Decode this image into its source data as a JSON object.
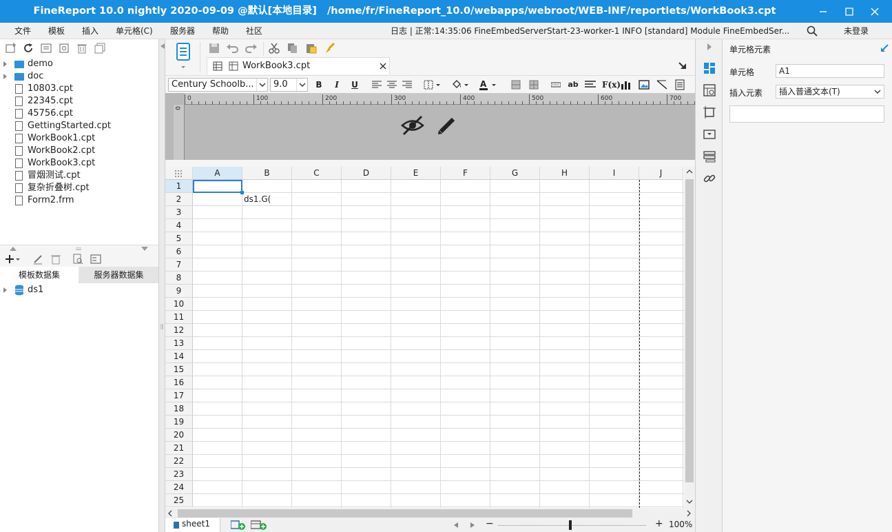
{
  "window": {
    "title": "FineReport 10.0 nightly 2020-09-09 @默认[本地目录]   /home/fr/FineReport_10.0/webapps/webroot/WEB-INF/reportlets/WorkBook3.cpt"
  },
  "menu": {
    "items": [
      "文件",
      "模板",
      "插入",
      "单元格(C)",
      "服务器",
      "帮助",
      "社区"
    ],
    "log": "日志 | 正常:14:35:06 FineEmbedServerStart-23-worker-1 INFO [standard] Module FineEmbedSer...",
    "login": "未登录"
  },
  "tree": {
    "items": [
      {
        "label": "demo",
        "type": "folder"
      },
      {
        "label": "doc",
        "type": "folder"
      },
      {
        "label": "10803.cpt",
        "type": "file"
      },
      {
        "label": "22345.cpt",
        "type": "file"
      },
      {
        "label": "45756.cpt",
        "type": "file"
      },
      {
        "label": "GettingStarted.cpt",
        "type": "file"
      },
      {
        "label": "WorkBook1.cpt",
        "type": "file"
      },
      {
        "label": "WorkBook2.cpt",
        "type": "file"
      },
      {
        "label": "WorkBook3.cpt",
        "type": "file"
      },
      {
        "label": "冒烟测试.cpt",
        "type": "file"
      },
      {
        "label": "复杂折叠树.cpt",
        "type": "file"
      },
      {
        "label": "Form2.frm",
        "type": "file"
      }
    ]
  },
  "datasets": {
    "tabs": [
      "模板数据集",
      "服务器数据集"
    ],
    "active_tab": 1,
    "items": [
      "ds1"
    ]
  },
  "editor": {
    "file_tab": "WorkBook3.cpt",
    "font": "Century Schoolb...",
    "font_size": "9.0",
    "ruler_marks": [
      "0",
      "100",
      "200",
      "300",
      "400",
      "500",
      "600",
      "700"
    ],
    "ruler_v_mark": "0"
  },
  "grid": {
    "columns": [
      "A",
      "B",
      "C",
      "D",
      "E",
      "F",
      "G",
      "H",
      "I",
      "J"
    ],
    "rows": [
      "1",
      "2",
      "3",
      "4",
      "5",
      "6",
      "7",
      "8",
      "9",
      "10",
      "11",
      "12",
      "13",
      "14",
      "15",
      "16",
      "17",
      "18",
      "19",
      "20",
      "21",
      "22",
      "23",
      "24",
      "25"
    ],
    "selected_cell": "A1",
    "cells": {
      "B2": "ds1.G("
    }
  },
  "status": {
    "sheet": "sheet1",
    "zoom": "100%",
    "zoom_minus": "−",
    "zoom_plus": "+"
  },
  "right_panel": {
    "title": "单元格元素",
    "cell_label": "单元格",
    "cell_value": "A1",
    "insert_label": "插入元素",
    "insert_value": "插入普通文本(T)"
  },
  "colors": {
    "titlebar": "#1a8ee0",
    "accent": "#1a8ee0",
    "selection": "#2a7fd4"
  }
}
